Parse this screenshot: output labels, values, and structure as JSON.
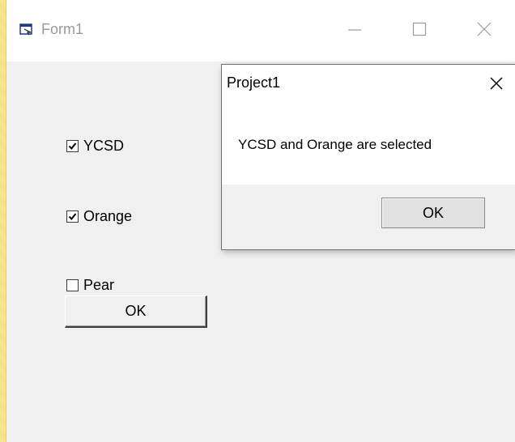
{
  "main_window": {
    "title": "Form1",
    "icon": "form-app-icon",
    "controls": {
      "minimize_icon": "minimize-icon",
      "maximize_icon": "maximize-icon",
      "close_icon": "close-icon"
    },
    "checkboxes": [
      {
        "label": "YCSD",
        "checked": true
      },
      {
        "label": "Orange",
        "checked": true
      },
      {
        "label": "Pear",
        "checked": false
      }
    ],
    "ok_button": "OK"
  },
  "dialog": {
    "title": "Project1",
    "message": "YCSD and Orange are selected",
    "ok_button": "OK",
    "close_icon": "close-icon"
  }
}
